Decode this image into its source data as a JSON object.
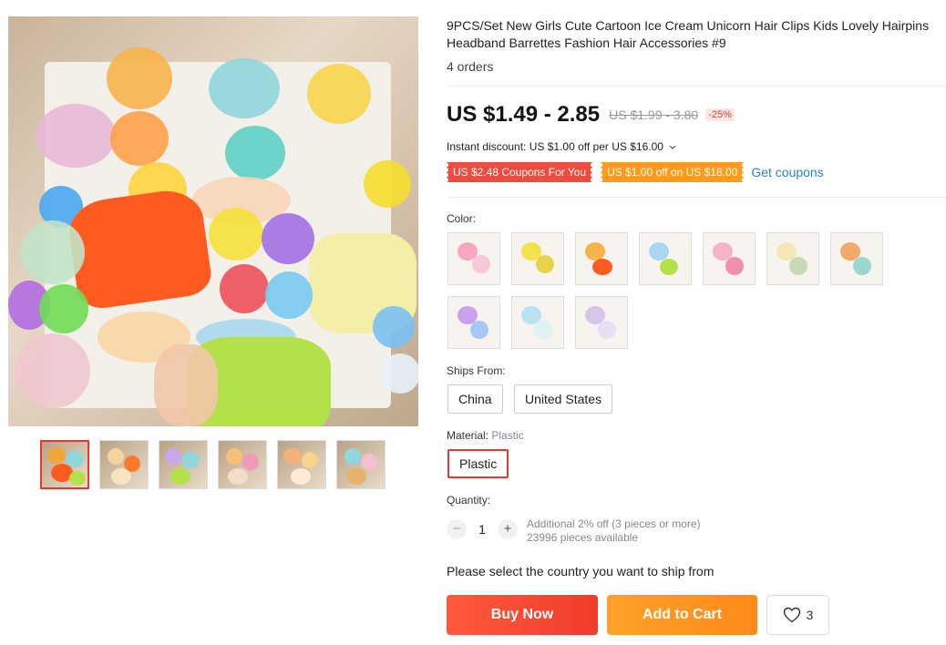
{
  "gallery": {
    "main_image_alt": "product image",
    "thumbnail_count": 6,
    "active_thumbnail": 1
  },
  "product": {
    "title": "9PCS/Set New Girls Cute Cartoon Ice Cream Unicorn Hair Clips Kids Lovely Hairpins Headband Barrettes Fashion Hair Accessories #9",
    "orders": "4 orders",
    "price": "US $1.49 - 2.85",
    "original_price": "US $1.99 - 3.80",
    "discount": "-25%"
  },
  "promotions": {
    "instant_discount": "Instant discount: US $1.00 off per US $16.00",
    "coupon_1": "US $2.48 Coupons For You",
    "coupon_2": "US $1.00 off on US $18.00",
    "get_coupons": "Get coupons"
  },
  "color": {
    "label": "Color:",
    "swatch_count": 10
  },
  "ships_from": {
    "label": "Ships From:",
    "options": [
      "China",
      "United States"
    ]
  },
  "material": {
    "label": "Material:",
    "value": "Plastic",
    "options": [
      "Plastic"
    ]
  },
  "quantity": {
    "label": "Quantity:",
    "value": "1",
    "minus": "−",
    "plus": "+",
    "note_line1": "Additional 2% off (3 pieces or more)",
    "note_line2": "23996 pieces available"
  },
  "ship_message": "Please select the country you want to ship from",
  "actions": {
    "buy_now": "Buy Now",
    "add_to_cart": "Add to Cart",
    "wishlist_count": "3"
  },
  "colors": {
    "accent_red": "#e23a2f",
    "buy_now": "#f4472f",
    "add_to_cart": "#ff951f",
    "link": "#2a86b9"
  }
}
